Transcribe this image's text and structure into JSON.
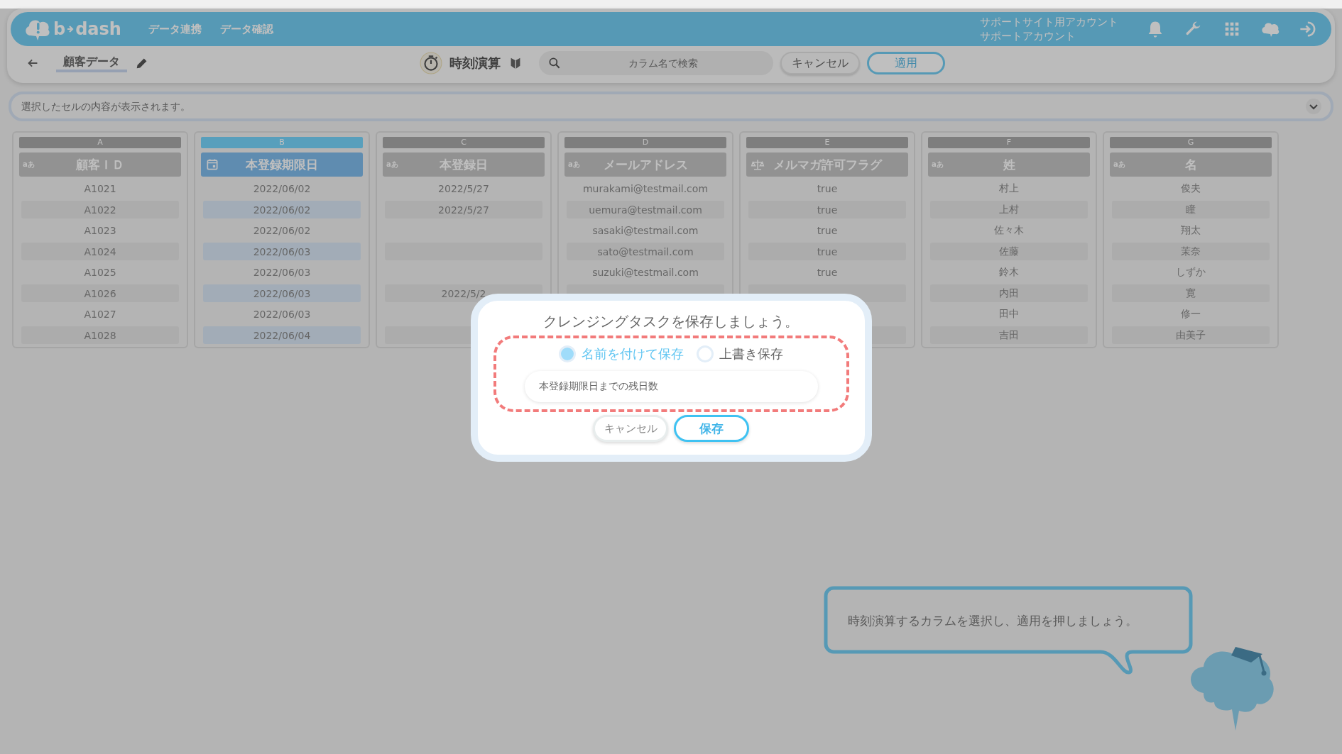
{
  "header": {
    "logo": {
      "left": "b",
      "right": "dash"
    },
    "nav": [
      "データ連携",
      "データ確認"
    ],
    "account": {
      "site": "サポートサイト用アカウント",
      "name": "サポートアカウント"
    }
  },
  "toolbar": {
    "dataset": "顧客データ",
    "mode": "時刻演算",
    "search": {
      "placeholder": "カラム名で検索"
    },
    "buttons": [
      {
        "label": "キャンセル",
        "kind": "secondary"
      },
      {
        "label": "適用",
        "kind": "primary"
      }
    ]
  },
  "cell_viewer": {
    "placeholder": "選択したセルの内容が表示されます。"
  },
  "columns": [
    {
      "letter": "A",
      "title": "顧客ＩＤ",
      "kind": "text",
      "type_label": "aあ",
      "selected": false,
      "cells": [
        "A1021",
        "A1022",
        "A1023",
        "A1024",
        "A1025",
        "A1026",
        "A1027",
        "A1028"
      ]
    },
    {
      "letter": "B",
      "title": "本登録期限日",
      "kind": "date",
      "selected": true,
      "cells": [
        "2022/06/02",
        "2022/06/02",
        "2022/06/02",
        "2022/06/03",
        "2022/06/03",
        "2022/06/03",
        "2022/06/03",
        "2022/06/04"
      ]
    },
    {
      "letter": "C",
      "title": "本登録日",
      "kind": "text",
      "type_label": "aあ",
      "selected": false,
      "cells": [
        "2022/5/27",
        "2022/5/27",
        null,
        null,
        null,
        "2022/5/2",
        null,
        null
      ]
    },
    {
      "letter": "D",
      "title": "メールアドレス",
      "kind": "text",
      "type_label": "aあ",
      "selected": false,
      "cells": [
        "murakami@testmail.com",
        "uemura@testmail.com",
        "sasaki@testmail.com",
        "sato@testmail.com",
        "suzuki@testmail.com",
        null,
        null
      ]
    },
    {
      "letter": "E",
      "title": "メルマガ許可フラグ",
      "kind": "flag",
      "selected": false,
      "cells": [
        "true",
        "true",
        "true",
        "true",
        "true",
        null,
        null,
        null
      ]
    },
    {
      "letter": "F",
      "title": "姓",
      "kind": "text",
      "type_label": "aあ",
      "selected": false,
      "cells": [
        "村上",
        "上村",
        "佐々木",
        "佐藤",
        "鈴木",
        "内田",
        "田中",
        "吉田"
      ]
    },
    {
      "letter": "G",
      "title": "名",
      "kind": "text",
      "type_label": "aあ",
      "selected": false,
      "cells": [
        "俊夫",
        "瞳",
        "翔太",
        "茉奈",
        "しずか",
        "寛",
        "修一",
        "由美子"
      ]
    }
  ],
  "dialog": {
    "title": "クレンジングタスクを保存しましょう。",
    "options": [
      {
        "label": "名前を付けて保存",
        "selected": true
      },
      {
        "label": "上書き保存",
        "selected": false
      }
    ],
    "name_field": {
      "value": "本登録期限日までの残日数"
    },
    "buttons": [
      {
        "label": "キャンセル",
        "kind": "secondary"
      },
      {
        "label": "保存",
        "kind": "primary"
      }
    ]
  },
  "hint": {
    "text": "時刻演算するカラムを選択し、適用を押しましょう。"
  }
}
